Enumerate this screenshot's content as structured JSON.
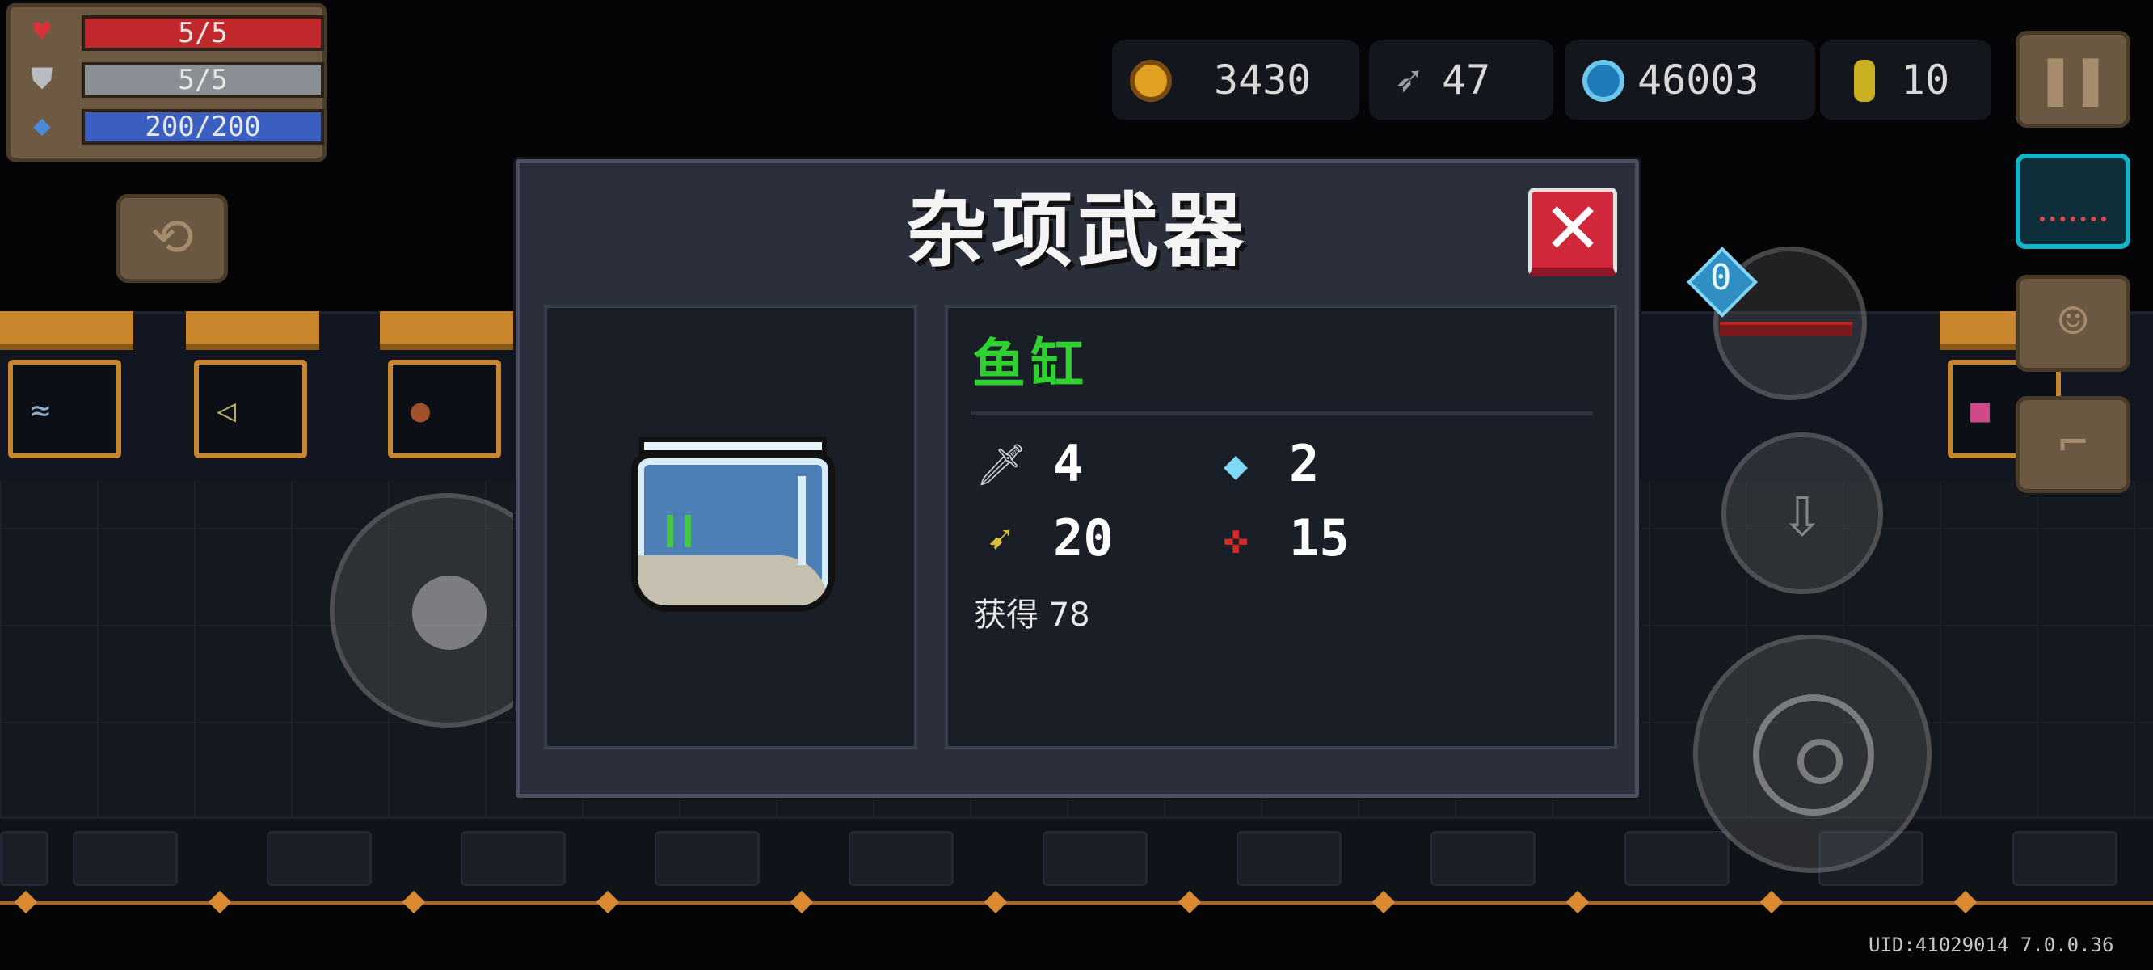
{
  "hud": {
    "health": {
      "text": "5/5",
      "fraction": 1.0,
      "color": "#c0282c"
    },
    "armor": {
      "text": "5/5",
      "fraction": 1.0,
      "color": "#8a8f96"
    },
    "energy": {
      "text": "200/200",
      "fraction": 1.0,
      "color": "#3a5fc0"
    }
  },
  "currency": {
    "gold": "3430",
    "fish": "47",
    "gems": "46003",
    "tokens": "10"
  },
  "dialog": {
    "title": "杂项武器",
    "close_label": "✕",
    "item_name": "鱼缸",
    "stats": {
      "damage": "4",
      "energy_cost": "2",
      "crit": "20",
      "accuracy": "15"
    },
    "acquired_label": "获得",
    "acquired_count": "78"
  },
  "controls": {
    "skill_cost": "0"
  },
  "footer": {
    "uid": "UID:41029014 7.0.0.36"
  },
  "icons": {
    "health": "heart-icon",
    "armor": "shield-icon",
    "energy": "diamond-icon",
    "gold": "gold-coin-icon",
    "fish": "fish-icon",
    "gems": "blue-gem-icon",
    "tokens": "token-icon",
    "damage": "sword-icon",
    "energy_cost": "energy-crystal-icon",
    "crit": "crit-knife-icon",
    "accuracy": "crosshair-icon"
  }
}
